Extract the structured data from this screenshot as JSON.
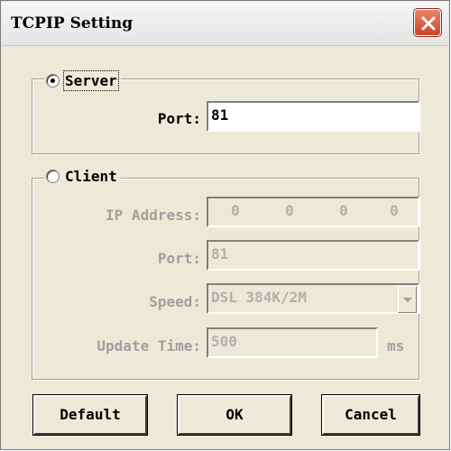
{
  "window": {
    "title": "TCPIP Setting"
  },
  "server": {
    "label": "Server",
    "selected": true,
    "port_label": "Port:",
    "port_value": "81"
  },
  "client": {
    "label": "Client",
    "selected": false,
    "ip_label": "IP Address:",
    "ip": [
      "0",
      "0",
      "0",
      "0"
    ],
    "port_label": "Port:",
    "port_value": "81",
    "speed_label": "Speed:",
    "speed_value": "DSL 384K/2M",
    "update_label": "Update Time:",
    "update_value": "500",
    "update_unit": "ms"
  },
  "buttons": {
    "default": "Default",
    "ok": "OK",
    "cancel": "Cancel"
  },
  "icons": {
    "close": "close-icon",
    "dropdown": "chevron-down-icon"
  },
  "colors": {
    "close_button": "#d9573c",
    "disabled_text": "#a0a0a0",
    "dialog_bg": "#ece9d8"
  }
}
